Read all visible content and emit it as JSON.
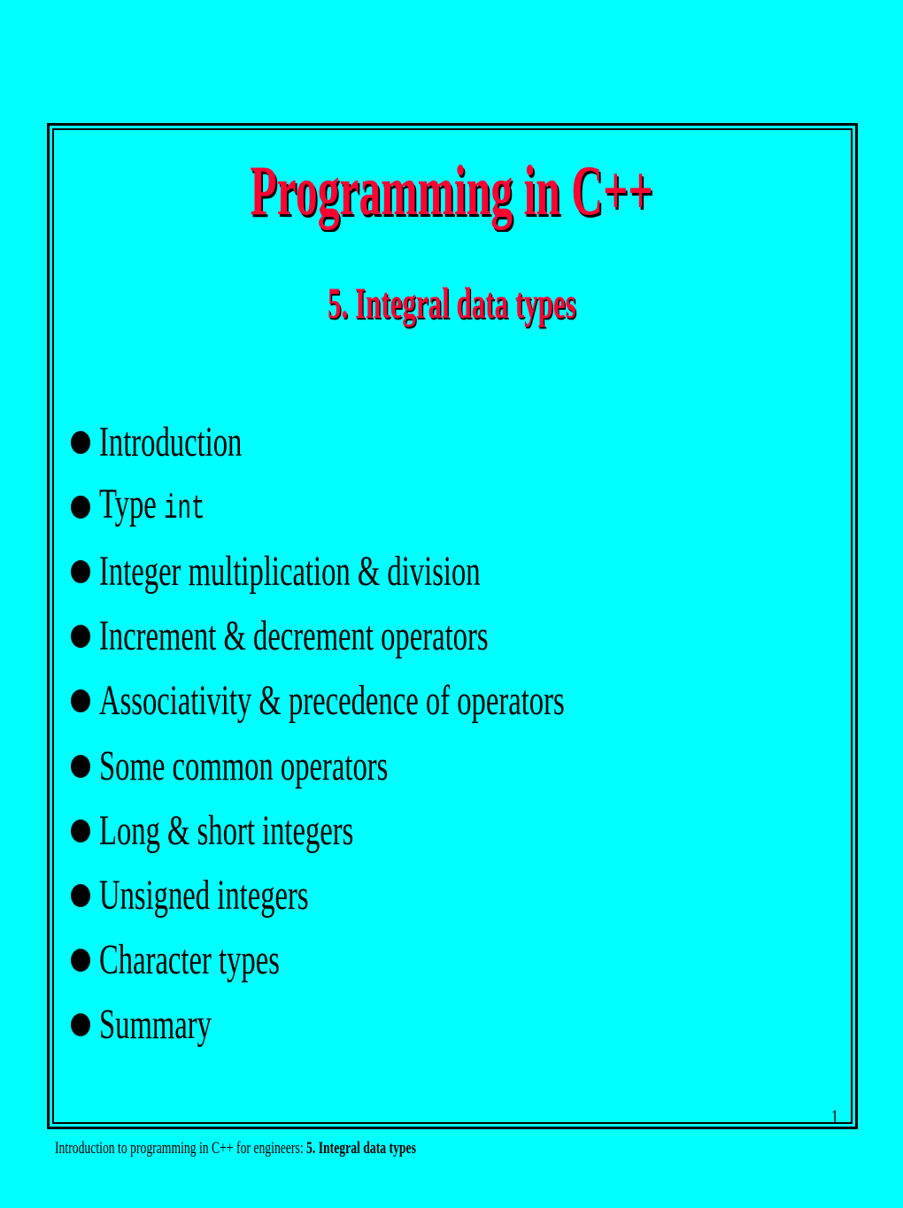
{
  "slide": {
    "title": "Programming in C++",
    "subtitle": "5. Integral data types",
    "bullets": [
      {
        "text": "Introduction",
        "code": ""
      },
      {
        "text": "Type ",
        "code": "int"
      },
      {
        "text": "Integer multiplication & division",
        "code": ""
      },
      {
        "text": "Increment & decrement operators",
        "code": ""
      },
      {
        "text": "Associativity & precedence of operators",
        "code": ""
      },
      {
        "text": "Some common operators",
        "code": ""
      },
      {
        "text": "Long & short integers",
        "code": ""
      },
      {
        "text": "Unsigned integers",
        "code": ""
      },
      {
        "text": "Character types",
        "code": ""
      },
      {
        "text": "Summary",
        "code": ""
      }
    ],
    "page_number": "1"
  },
  "footer": {
    "prefix": "Introduction to programming in C++ for engineers: ",
    "chapter": "5. Integral data types"
  },
  "colors": {
    "background": "#00ffff",
    "title": "#ff0033",
    "text": "#000000"
  }
}
